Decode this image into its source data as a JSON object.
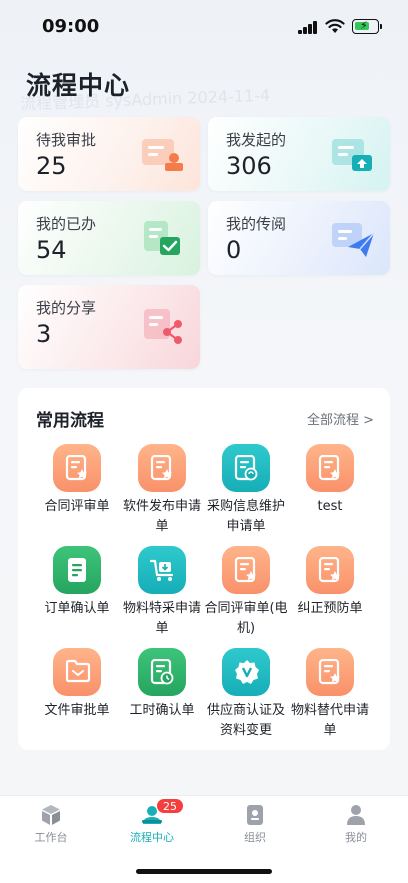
{
  "status_bar": {
    "time": "09:00"
  },
  "watermark": "流程管理员 sysAdmin 2024-11-4",
  "page": {
    "title": "流程中心"
  },
  "summary_cards": [
    {
      "label": "待我审批",
      "count": "25",
      "icon": "approval-stamp-icon",
      "color": "#f9916a"
    },
    {
      "label": "我发起的",
      "count": "306",
      "icon": "upload-document-icon",
      "color": "#16aeb7"
    },
    {
      "label": "我的已办",
      "count": "54",
      "icon": "checked-document-icon",
      "color": "#25a55f"
    },
    {
      "label": "我的传阅",
      "count": "0",
      "icon": "send-document-icon",
      "color": "#3e7bf0"
    },
    {
      "label": "我的分享",
      "count": "3",
      "icon": "share-document-icon",
      "color": "#ef5a6a"
    }
  ],
  "common_flows": {
    "title": "常用流程",
    "all_link": "全部流程 >",
    "items": [
      {
        "label": "合同评审单",
        "icon": "document-star-icon",
        "color": "orange"
      },
      {
        "label": "软件发布申请单",
        "icon": "document-star-icon",
        "color": "orange"
      },
      {
        "label": "采购信息维护申请单",
        "icon": "document-refresh-icon",
        "color": "teal"
      },
      {
        "label": "test",
        "icon": "document-star-icon",
        "color": "orange"
      },
      {
        "label": "订单确认单",
        "icon": "list-document-icon",
        "color": "green"
      },
      {
        "label": "物料特采申请单",
        "icon": "cart-icon",
        "color": "teal"
      },
      {
        "label": "合同评审单(电机)",
        "icon": "document-star-icon",
        "color": "orange"
      },
      {
        "label": "纠正预防单",
        "icon": "document-star-icon",
        "color": "orange"
      },
      {
        "label": "文件审批单",
        "icon": "folder-icon",
        "color": "orange"
      },
      {
        "label": "工时确认单",
        "icon": "clock-document-icon",
        "color": "green"
      },
      {
        "label": "供应商认证及资料变更",
        "icon": "verified-badge-icon",
        "color": "teal"
      },
      {
        "label": "物料替代申请单",
        "icon": "document-star-icon",
        "color": "orange"
      }
    ]
  },
  "tabbar": {
    "items": [
      {
        "label": "工作台",
        "icon": "cube-icon"
      },
      {
        "label": "流程中心",
        "icon": "flow-center-icon",
        "badge": "25",
        "active": true
      },
      {
        "label": "组织",
        "icon": "organization-icon"
      },
      {
        "label": "我的",
        "icon": "user-icon"
      }
    ]
  }
}
